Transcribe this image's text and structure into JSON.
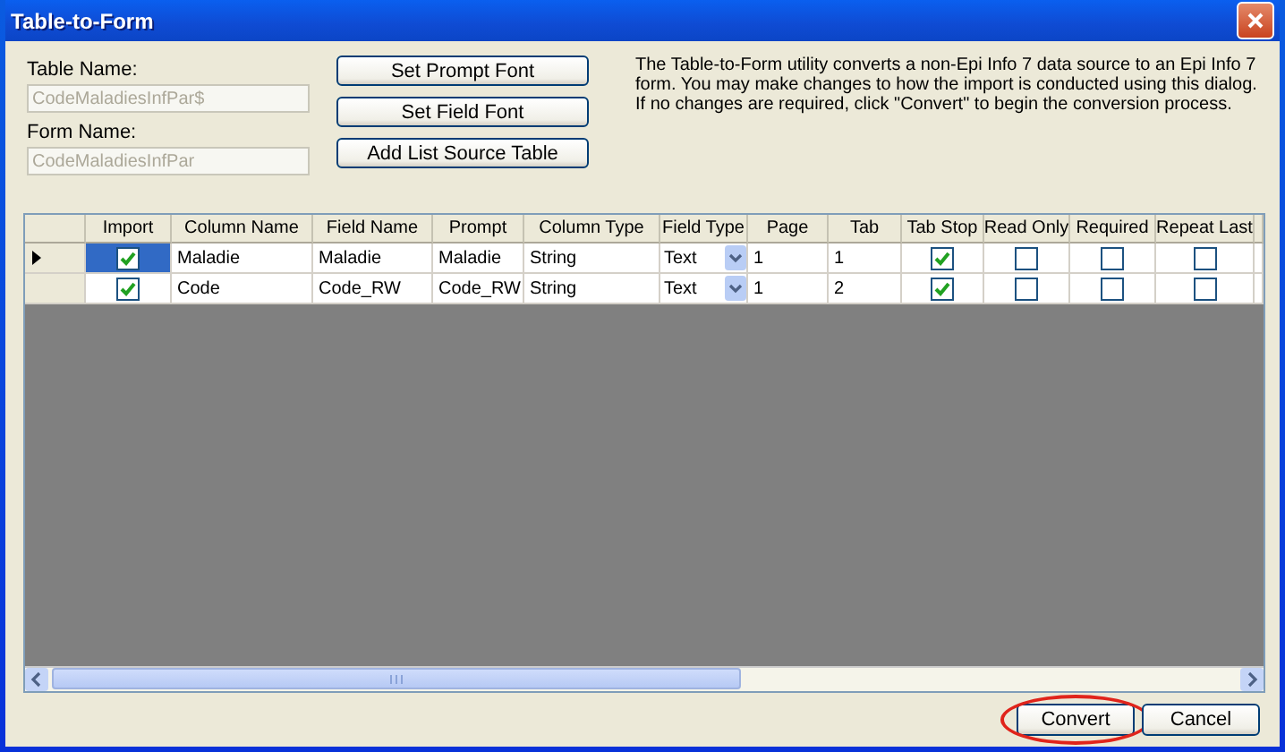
{
  "window": {
    "title": "Table-to-Form"
  },
  "table_name": {
    "label": "Table Name:",
    "value": "CodeMaladiesInfPar$",
    "disabled": true
  },
  "form_name": {
    "label": "Form Name:",
    "value": "CodeMaladiesInfPar",
    "disabled": true
  },
  "side_buttons": [
    "Set Prompt Font",
    "Set Field Font",
    "Add List Source Table"
  ],
  "description": "The Table-to-Form utility converts a non-Epi Info 7 data source to an Epi Info 7 form. You may make changes to how the import is conducted using this dialog. If no changes are required, click \"Convert\" to begin the conversion process.",
  "grid": {
    "columns": [
      "Import",
      "Column Name",
      "Field Name",
      "Prompt",
      "Column Type",
      "Field Type",
      "Page",
      "Tab",
      "Tab Stop",
      "Read Only",
      "Required",
      "Repeat Last"
    ],
    "rows": [
      {
        "selected": true,
        "import": true,
        "column_name": "Maladie",
        "field_name": "Maladie",
        "prompt": "Maladie",
        "column_type": "String",
        "field_type": "Text",
        "page": "1",
        "tab": "1",
        "tab_stop": true,
        "read_only": false,
        "required": false,
        "repeat_last": false
      },
      {
        "selected": false,
        "import": true,
        "column_name": "Code",
        "field_name": "Code_RW",
        "prompt": "Code_RW",
        "column_type": "String",
        "field_type": "Text",
        "page": "1",
        "tab": "2",
        "tab_stop": true,
        "read_only": false,
        "required": false,
        "repeat_last": false
      }
    ]
  },
  "buttons": [
    {
      "label": "Convert",
      "highlighted": true
    },
    {
      "label": "Cancel",
      "highlighted": false
    }
  ]
}
